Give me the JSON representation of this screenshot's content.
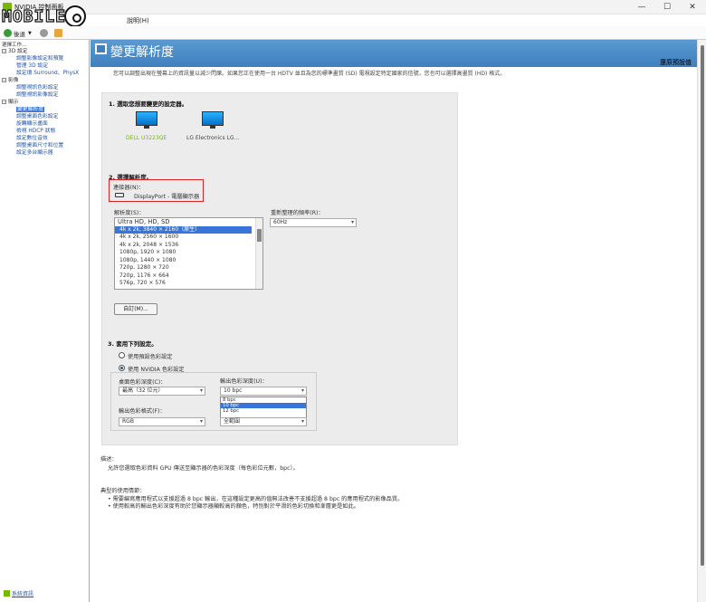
{
  "window": {
    "title": "NVIDIA 控制面板",
    "minimize": "—",
    "maximize": "☐",
    "close": "✕"
  },
  "watermark": {
    "text": "MOBILE"
  },
  "menu": {
    "help": "說明(H)"
  },
  "toolbar": {
    "back_label": "後退",
    "back_arrow": "▼"
  },
  "sidebar": {
    "task_label": "選擇工作...",
    "items": [
      {
        "label": "3D 設定",
        "type": "cat",
        "box": "−"
      },
      {
        "label": "調整影像設定和預覽",
        "type": "sub"
      },
      {
        "label": "管理 3D 設定",
        "type": "sub"
      },
      {
        "label": "設定環 Surround、PhysX",
        "type": "sub"
      },
      {
        "label": "影像",
        "type": "cat",
        "box": "−"
      },
      {
        "label": "調整視訊色彩設定",
        "type": "sub"
      },
      {
        "label": "調整視訊影像設定",
        "type": "sub"
      },
      {
        "label": "顯示",
        "type": "cat",
        "box": "−"
      },
      {
        "label": "變更解析度",
        "type": "sub",
        "selected": true
      },
      {
        "label": "調整桌面色彩設定",
        "type": "sub"
      },
      {
        "label": "旋轉顯示畫面",
        "type": "sub"
      },
      {
        "label": "檢視 HDCP 狀態",
        "type": "sub"
      },
      {
        "label": "設定數位音效",
        "type": "sub"
      },
      {
        "label": "調整桌面尺寸和位置",
        "type": "sub"
      },
      {
        "label": "設定多台顯示器",
        "type": "sub"
      }
    ],
    "bottom_link": "系統資訊"
  },
  "page": {
    "title": "變更解析度",
    "restore_defaults": "還原預設值",
    "intro": "您可以調整出現在螢幕上的資訊量以減少閃爍。如果您正在使用一台 HDTV 並且為您的標準畫質 (SD) 電視設定特定國家的信號，您也可以選擇高畫質 (HD) 格式。"
  },
  "section1": {
    "heading": "1. 選取您想要變更的設定器。",
    "displays": [
      {
        "label": "DELL U3223QE",
        "selected": true
      },
      {
        "label": "LG Electronics LG..."
      }
    ]
  },
  "section2": {
    "heading": "2. 選擇解析度。",
    "connector_label": "連接器(N)：",
    "connector_value": "DisplayPort - 電腦顯示器",
    "resolution_label": "解析度(S)：",
    "resolution_group": "Ultra HD, HD, SD",
    "resolutions": [
      {
        "label": "4k x 2k, 3840 × 2160（原生）",
        "selected": true
      },
      {
        "label": "4k x 2k, 2560 × 1600"
      },
      {
        "label": "4k x 2k, 2048 × 1536"
      },
      {
        "label": "1080p, 1920 × 1080"
      },
      {
        "label": "1080p, 1440 × 1080"
      },
      {
        "label": "720p, 1280 × 720"
      },
      {
        "label": "720p, 1176 × 664"
      },
      {
        "label": "576p, 720 × 576"
      }
    ],
    "refresh_label": "重新整理的頻率(R)：",
    "refresh_value": "60Hz",
    "custom_button": "自訂(M)..."
  },
  "section3": {
    "heading": "3. 套用下列設定。",
    "radio_default": "使用預設色彩設定",
    "radio_nvidia": "使用 NVIDIA 色彩設定",
    "desktop_depth_label": "桌面色彩深度(C)：",
    "desktop_depth_value": "最高（32 位元）",
    "output_depth_label": "輸出色彩深度(U)：",
    "output_depth_value": "10 bpc",
    "output_depth_options": [
      "8 bpc",
      "10 bpc",
      "12 bpc"
    ],
    "output_depth_selected_index": 1,
    "output_format_label": "輸出色彩格式(F)：",
    "output_format_value": "RGB",
    "dynamic_range_value": "全範圍"
  },
  "description": {
    "label": "描述：",
    "text": "允許您選取色彩資料 GPU 傳送至顯示器的色彩深度（每色彩位元數，bpc）。",
    "usage_label": "典型的使用情節：",
    "usage": [
      "需要編寫應用程式以支援超過 8 bpc 輸出，在這種設定更高的值無法改善不支援超過 8 bpc 的應用程式的影像品質。",
      "使用較高的輸出色彩深度有助於您顯示器顯較高的顏色，特別對於平滑的色彩切換和漸層更是如此。"
    ]
  },
  "colors": {
    "banner": "#4a8cc8",
    "selection": "#3875d7",
    "highlight_border": "#d22222",
    "nvidia_green": "#76b900"
  }
}
